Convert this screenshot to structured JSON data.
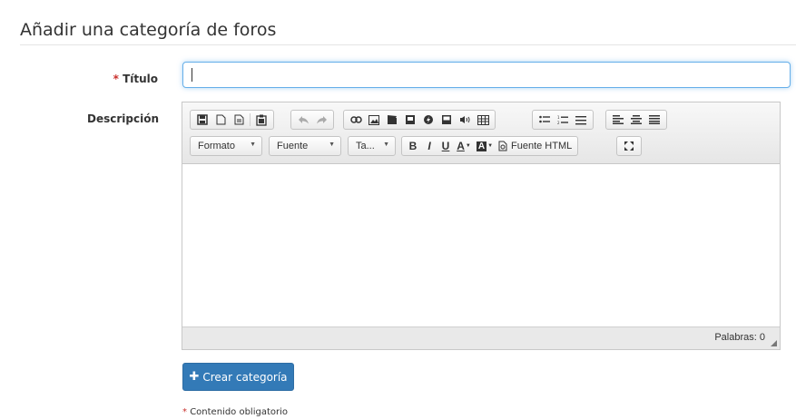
{
  "page": {
    "heading": "Añadir una categoría de foros"
  },
  "form": {
    "title_label": "Título",
    "required_mark": "*",
    "title_value": "",
    "description_label": "Descripción",
    "submit_label": "Crear categoría",
    "required_note": "Contenido obligatorio"
  },
  "editor": {
    "combos": {
      "format": "Formato",
      "font": "Fuente",
      "size": "Ta..."
    },
    "source_label": "Fuente HTML",
    "word_count": "Palabras: 0",
    "buttons": {
      "bold": "B",
      "italic": "I",
      "underline": "U",
      "text_color": "A",
      "bg_color": "A"
    }
  },
  "colors": {
    "primary": "#337ab7",
    "required": "#c9302c",
    "focus": "#66afe9"
  }
}
